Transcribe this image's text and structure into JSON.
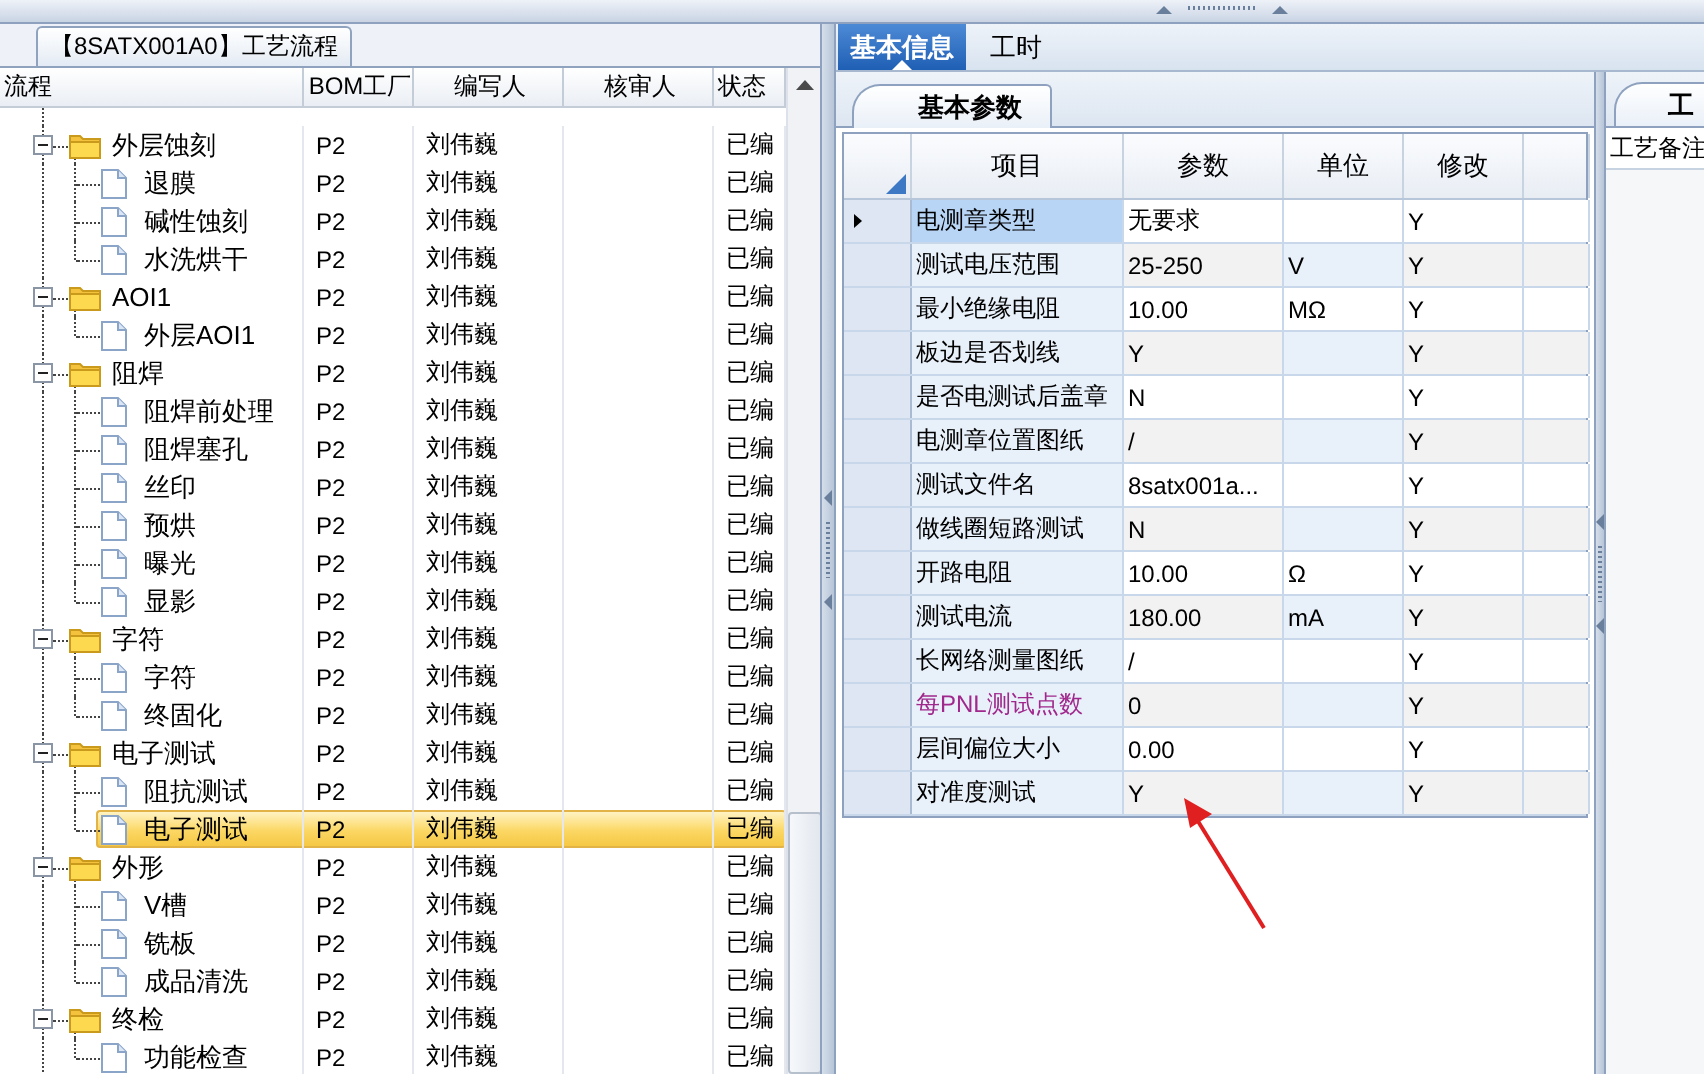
{
  "left_panel": {
    "group_title": "【8SATX001A0】工艺流程",
    "columns": [
      "流程",
      "BOM工厂",
      "编写人",
      "核审人",
      "状态"
    ],
    "tree": [
      {
        "kind": "folder",
        "name": "外层蚀刻",
        "factory": "P2",
        "author": "刘伟巍",
        "status": "已编",
        "expanded": true,
        "selected": false,
        "children": [
          {
            "kind": "document",
            "name": "退膜",
            "factory": "P2",
            "author": "刘伟巍",
            "status": "已编",
            "selected": false
          },
          {
            "kind": "document",
            "name": "碱性蚀刻",
            "factory": "P2",
            "author": "刘伟巍",
            "status": "已编",
            "selected": false
          },
          {
            "kind": "document",
            "name": "水洗烘干",
            "factory": "P2",
            "author": "刘伟巍",
            "status": "已编",
            "selected": false
          }
        ]
      },
      {
        "kind": "folder",
        "name": "AOI1",
        "factory": "P2",
        "author": "刘伟巍",
        "status": "已编",
        "expanded": true,
        "selected": false,
        "children": [
          {
            "kind": "document",
            "name": "外层AOI1",
            "factory": "P2",
            "author": "刘伟巍",
            "status": "已编",
            "selected": false
          }
        ]
      },
      {
        "kind": "folder",
        "name": "阻焊",
        "factory": "P2",
        "author": "刘伟巍",
        "status": "已编",
        "expanded": true,
        "selected": false,
        "children": [
          {
            "kind": "document",
            "name": "阻焊前处理",
            "factory": "P2",
            "author": "刘伟巍",
            "status": "已编",
            "selected": false
          },
          {
            "kind": "document",
            "name": "阻焊塞孔",
            "factory": "P2",
            "author": "刘伟巍",
            "status": "已编",
            "selected": false
          },
          {
            "kind": "document",
            "name": "丝印",
            "factory": "P2",
            "author": "刘伟巍",
            "status": "已编",
            "selected": false
          },
          {
            "kind": "document",
            "name": "预烘",
            "factory": "P2",
            "author": "刘伟巍",
            "status": "已编",
            "selected": false
          },
          {
            "kind": "document",
            "name": "曝光",
            "factory": "P2",
            "author": "刘伟巍",
            "status": "已编",
            "selected": false
          },
          {
            "kind": "document",
            "name": "显影",
            "factory": "P2",
            "author": "刘伟巍",
            "status": "已编",
            "selected": false
          }
        ]
      },
      {
        "kind": "folder",
        "name": "字符",
        "factory": "P2",
        "author": "刘伟巍",
        "status": "已编",
        "expanded": true,
        "selected": false,
        "children": [
          {
            "kind": "document",
            "name": "字符",
            "factory": "P2",
            "author": "刘伟巍",
            "status": "已编",
            "selected": false
          },
          {
            "kind": "document",
            "name": "终固化",
            "factory": "P2",
            "author": "刘伟巍",
            "status": "已编",
            "selected": false
          }
        ]
      },
      {
        "kind": "folder",
        "name": "电子测试",
        "factory": "P2",
        "author": "刘伟巍",
        "status": "已编",
        "expanded": true,
        "selected": false,
        "children": [
          {
            "kind": "document",
            "name": "阻抗测试",
            "factory": "P2",
            "author": "刘伟巍",
            "status": "已编",
            "selected": false
          },
          {
            "kind": "document",
            "name": "电子测试",
            "factory": "P2",
            "author": "刘伟巍",
            "status": "已编",
            "selected": true
          }
        ]
      },
      {
        "kind": "folder",
        "name": "外形",
        "factory": "P2",
        "author": "刘伟巍",
        "status": "已编",
        "expanded": true,
        "selected": false,
        "children": [
          {
            "kind": "document",
            "name": "V槽",
            "factory": "P2",
            "author": "刘伟巍",
            "status": "已编",
            "selected": false
          },
          {
            "kind": "document",
            "name": "铣板",
            "factory": "P2",
            "author": "刘伟巍",
            "status": "已编",
            "selected": false
          },
          {
            "kind": "document",
            "name": "成品清洗",
            "factory": "P2",
            "author": "刘伟巍",
            "status": "已编",
            "selected": false
          }
        ]
      },
      {
        "kind": "folder",
        "name": "终检",
        "factory": "P2",
        "author": "刘伟巍",
        "status": "已编",
        "expanded": true,
        "selected": false,
        "children": [
          {
            "kind": "document",
            "name": "功能检查",
            "factory": "P2",
            "author": "刘伟巍",
            "status": "已编",
            "selected": false
          }
        ]
      }
    ]
  },
  "tabs": [
    {
      "label": "基本信息",
      "selected": true
    },
    {
      "label": "工时",
      "selected": false
    }
  ],
  "params_panel": {
    "tab": "基本参数",
    "columns": [
      "项目",
      "参数",
      "单位",
      "修改"
    ],
    "rows": [
      {
        "item": "电测章类型",
        "value": "无要求",
        "unit": "",
        "modify": "Y",
        "selected": true,
        "color": "#000000"
      },
      {
        "item": "测试电压范围",
        "value": "25-250",
        "unit": "V",
        "modify": "Y",
        "selected": false,
        "color": "#000000"
      },
      {
        "item": "最小绝缘电阻",
        "value": "10.00",
        "unit": "MΩ",
        "modify": "Y",
        "selected": false,
        "color": "#000000"
      },
      {
        "item": "板边是否划线",
        "value": "Y",
        "unit": "",
        "modify": "Y",
        "selected": false,
        "color": "#000000"
      },
      {
        "item": "是否电测试后盖章",
        "value": "N",
        "unit": "",
        "modify": "Y",
        "selected": false,
        "color": "#000000"
      },
      {
        "item": "电测章位置图纸",
        "value": "/",
        "unit": "",
        "modify": "Y",
        "selected": false,
        "color": "#000000"
      },
      {
        "item": "测试文件名",
        "value": "8satx001a...",
        "unit": "",
        "modify": "Y",
        "selected": false,
        "color": "#000000"
      },
      {
        "item": "做线圈短路测试",
        "value": "N",
        "unit": "",
        "modify": "Y",
        "selected": false,
        "color": "#000000"
      },
      {
        "item": "开路电阻",
        "value": "10.00",
        "unit": "Ω",
        "modify": "Y",
        "selected": false,
        "color": "#000000"
      },
      {
        "item": "测试电流",
        "value": "180.00",
        "unit": "mA",
        "modify": "Y",
        "selected": false,
        "color": "#000000"
      },
      {
        "item": "长网络测量图纸",
        "value": "/",
        "unit": "",
        "modify": "Y",
        "selected": false,
        "color": "#000000"
      },
      {
        "item": "每PNL测试点数",
        "value": "0",
        "unit": "",
        "modify": "Y",
        "selected": false,
        "color": "#a0288c"
      },
      {
        "item": "层间偏位大小",
        "value": "0.00",
        "unit": "",
        "modify": "Y",
        "selected": false,
        "color": "#000000"
      },
      {
        "item": "对准度测试",
        "value": "Y",
        "unit": "",
        "modify": "Y",
        "selected": false,
        "color": "#000000"
      }
    ]
  },
  "side_panel": {
    "tab": "工",
    "label": "工艺备注"
  }
}
